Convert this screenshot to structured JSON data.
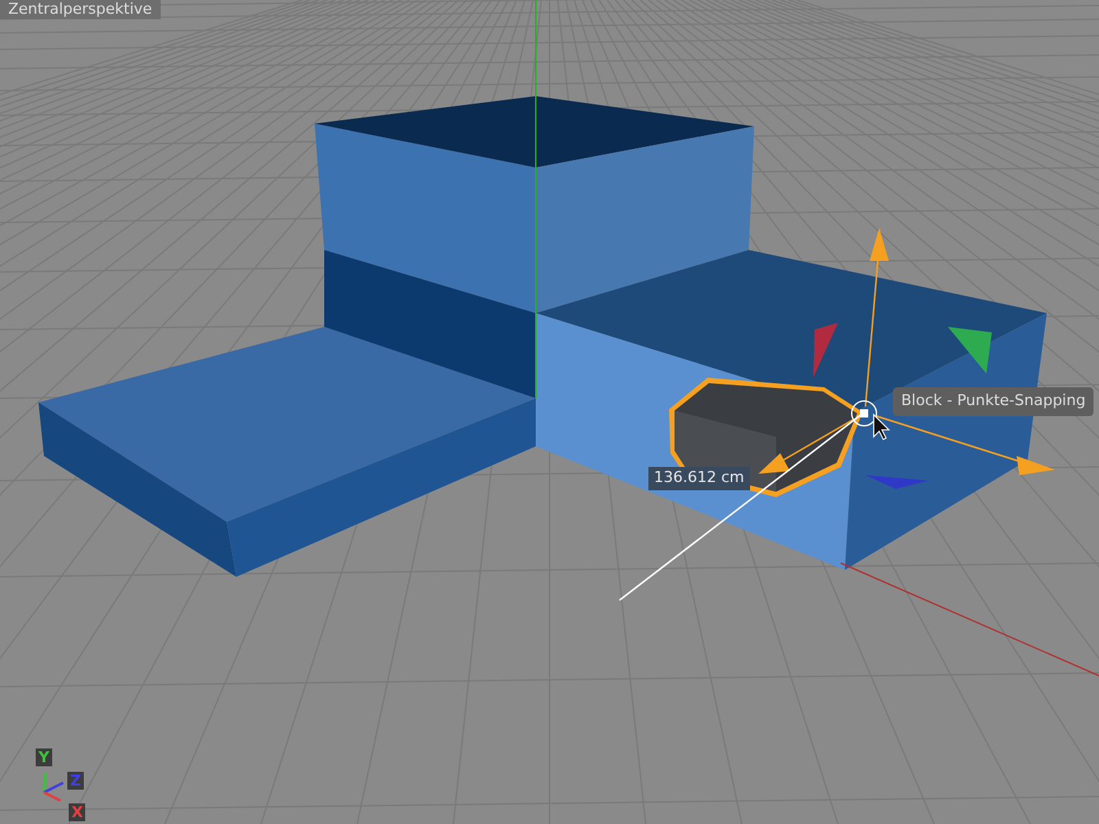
{
  "viewport": {
    "title": "Zentralperspektive"
  },
  "tooltip": {
    "text": "Block - Punkte-Snapping"
  },
  "measurement": {
    "text": "136.612 cm"
  },
  "axis_indicator": [
    {
      "label": "Y",
      "color": "#3fbf3f"
    },
    {
      "label": "Z",
      "color": "#4040e0"
    },
    {
      "label": "X",
      "color": "#e04040"
    }
  ]
}
